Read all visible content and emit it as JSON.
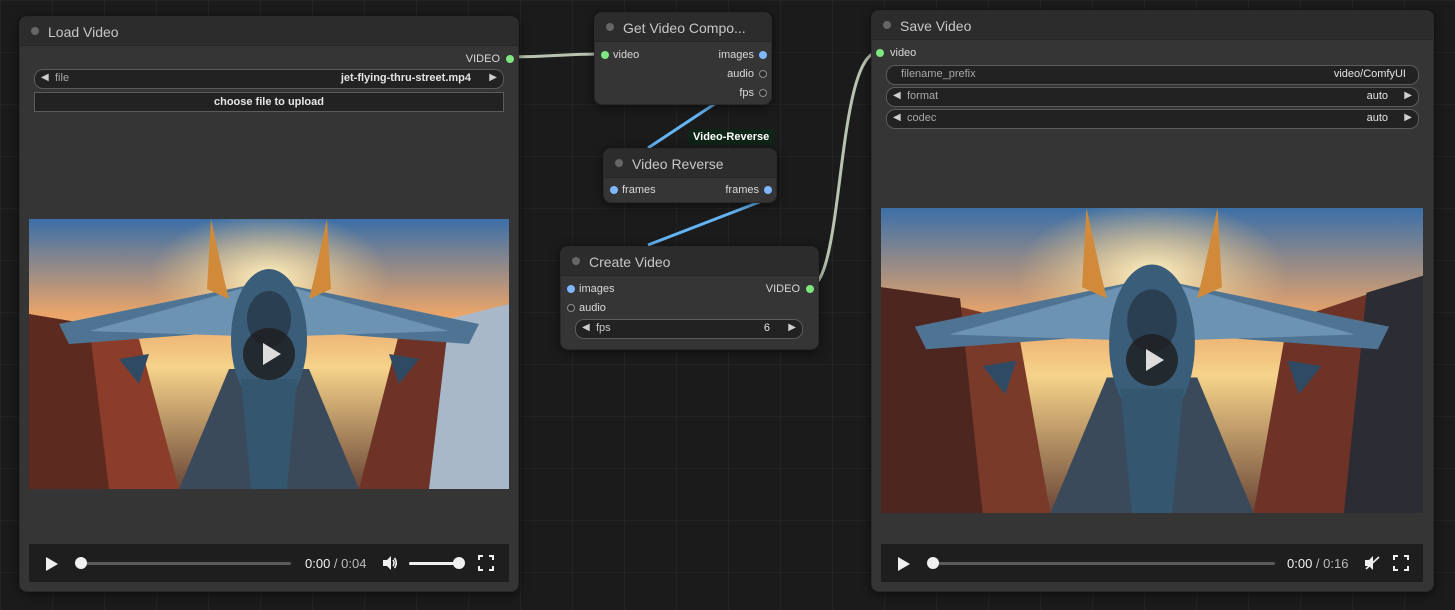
{
  "colors": {
    "canvas_bg": "#1b1b1b",
    "node_bg": "#353535",
    "node_title_bg": "#2c2c2c",
    "video_link": "#b8c4b0",
    "image_link": "#64b5f6",
    "video_slot": "#7ee87e",
    "image_slot": "#7fb6ff",
    "badge_bg": "#0e2416"
  },
  "load_video": {
    "title": "Load Video",
    "output_video": "VIDEO",
    "file_label": "file",
    "file_value": "jet-flying-thru-street.mp4",
    "upload_label": "choose file to upload",
    "player": {
      "current_time": "0:00",
      "separator": " / ",
      "duration": "0:04",
      "progress": 0,
      "volume": 1.0,
      "muted": false
    }
  },
  "get_components": {
    "title": "Get Video Compo...",
    "input_video": "video",
    "output_images": "images",
    "output_audio": "audio",
    "output_fps": "fps"
  },
  "reverse": {
    "title": "Video Reverse",
    "input_frames": "frames",
    "output_frames": "frames",
    "badge": "Video-Reverse"
  },
  "create_video": {
    "title": "Create Video",
    "input_images": "images",
    "input_audio": "audio",
    "output_video": "VIDEO",
    "fps_label": "fps",
    "fps_value": "6"
  },
  "save_video": {
    "title": "Save Video",
    "input_video": "video",
    "filename_label": "filename_prefix",
    "filename_value": "video/ComfyUI",
    "format_label": "format",
    "format_value": "auto",
    "codec_label": "codec",
    "codec_value": "auto",
    "player": {
      "current_time": "0:00",
      "separator": " / ",
      "duration": "0:16",
      "progress": 0,
      "muted": true
    }
  }
}
